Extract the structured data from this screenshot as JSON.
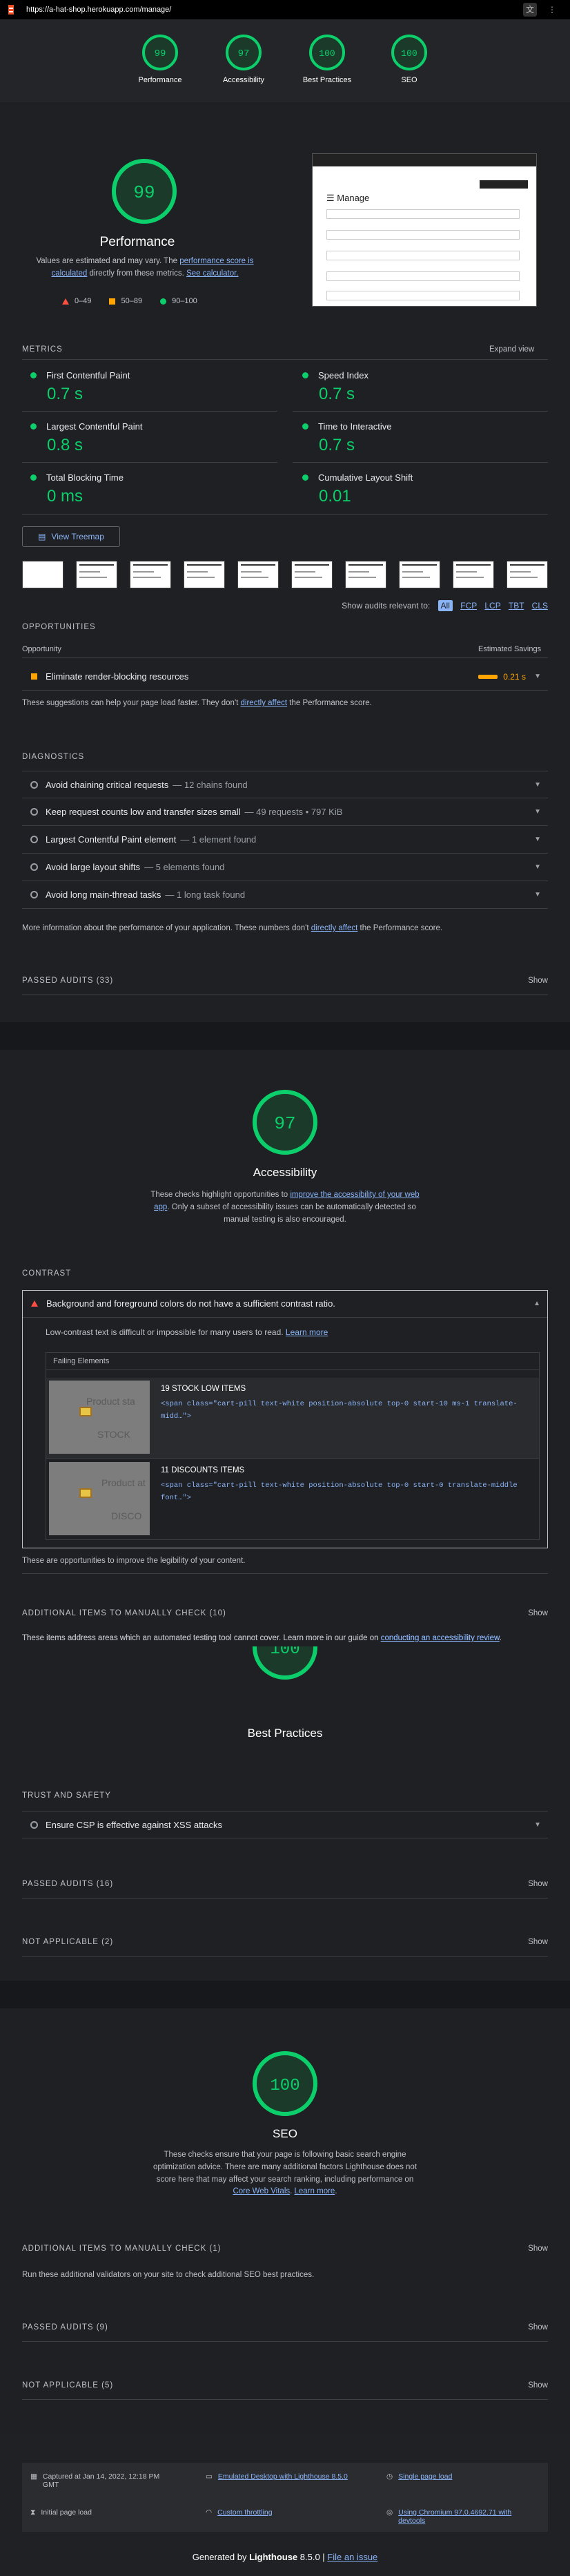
{
  "browser": {
    "url": "https://a-hat-shop.herokuapp.com/manage/"
  },
  "summary": [
    {
      "label": "Performance",
      "score": "99"
    },
    {
      "label": "Accessibility",
      "score": "97"
    },
    {
      "label": "Best Practices",
      "score": "100"
    },
    {
      "label": "SEO",
      "score": "100"
    }
  ],
  "performance": {
    "score": "99",
    "title": "Performance",
    "desc_1": "Values are estimated and may vary. The ",
    "desc_link_1": "performance score is calculated",
    "desc_2": " directly from these metrics. ",
    "desc_link_2": "See calculator.",
    "legend": [
      "0–49",
      "50–89",
      "90–100"
    ],
    "preview_title": "Manage",
    "metrics_header": "METRICS",
    "expand_view": "Expand view",
    "metrics": [
      {
        "name": "First Contentful Paint",
        "value": "0.7 s"
      },
      {
        "name": "Speed Index",
        "value": "0.7 s"
      },
      {
        "name": "Largest Contentful Paint",
        "value": "0.8 s"
      },
      {
        "name": "Time to Interactive",
        "value": "0.7 s"
      },
      {
        "name": "Total Blocking Time",
        "value": "0 ms"
      },
      {
        "name": "Cumulative Layout Shift",
        "value": "0.01"
      }
    ],
    "treemap": "View Treemap",
    "filter_label": "Show audits relevant to:",
    "filters": [
      "All",
      "FCP",
      "LCP",
      "TBT",
      "CLS"
    ],
    "opportunities_header": "OPPORTUNITIES",
    "opportunity_col": "Opportunity",
    "savings_col": "Estimated Savings",
    "opportunity": {
      "name": "Eliminate render-blocking resources",
      "savings": "0.21 s"
    },
    "opp_note_1": "These suggestions can help your page load faster. They don't ",
    "opp_note_link": "directly affect",
    "opp_note_2": " the Performance score.",
    "diagnostics_header": "DIAGNOSTICS",
    "diagnostics": [
      {
        "name": "Avoid chaining critical requests",
        "sub": "— 12 chains found"
      },
      {
        "name": "Keep request counts low and transfer sizes small",
        "sub": "— 49 requests • 797 KiB"
      },
      {
        "name": "Largest Contentful Paint element",
        "sub": "— 1 element found"
      },
      {
        "name": "Avoid large layout shifts",
        "sub": "— 5 elements found"
      },
      {
        "name": "Avoid long main-thread tasks",
        "sub": "— 1 long task found"
      }
    ],
    "diag_note_1": "More information about the performance of your application. These numbers don't ",
    "diag_note_link": "directly affect",
    "diag_note_2": " the Performance score.",
    "passed": "PASSED AUDITS (33)",
    "show": "Show"
  },
  "accessibility": {
    "score": "97",
    "title": "Accessibility",
    "desc_1": "These checks highlight opportunities to ",
    "desc_link": "improve the accessibility of your web app",
    "desc_2": ". Only a subset of accessibility issues can be automatically detected so manual testing is also encouraged.",
    "contrast_header": "CONTRAST",
    "contrast_audit": "Background and foreground colors do not have a sufficient contrast ratio.",
    "contrast_desc": "Low-contrast text is difficult or impossible for many users to read. ",
    "learn_more": "Learn more",
    "failing_header": "Failing Elements",
    "failing": [
      {
        "name": "19 STOCK LOW ITEMS",
        "code": "<span class=\"cart-pill text-white position-absolute top-0 start-10 ms-1 translate-midd…\">",
        "shot_text_1": "Product sta",
        "shot_text_2": "STOCK"
      },
      {
        "name": "11 DISCOUNTS ITEMS",
        "code": "<span class=\"cart-pill text-white position-absolute top-0 start-0 translate-middle font…\">",
        "shot_text_1": "Product at",
        "shot_text_2": "DISCO"
      }
    ],
    "contrast_note": "These are opportunities to improve the legibility of your content.",
    "manual_header": "ADDITIONAL ITEMS TO MANUALLY CHECK (10)",
    "manual_note_1": "These items address areas which an automated testing tool cannot cover. Learn more in our guide on ",
    "manual_note_link": "conducting an accessibility review",
    "manual_note_2": ".",
    "show": "Show"
  },
  "best_practices": {
    "score": "100",
    "title": "Best Practices",
    "trust_header": "TRUST AND SAFETY",
    "csp": "Ensure CSP is effective against XSS attacks",
    "passed": "PASSED AUDITS (16)",
    "na": "NOT APPLICABLE (2)",
    "show": "Show"
  },
  "seo": {
    "score": "100",
    "title": "SEO",
    "desc_1": "These checks ensure that your page is following basic search engine optimization advice. There are many additional factors Lighthouse does not score here that may affect your search ranking, including performance on ",
    "desc_link_1": "Core Web Vitals",
    "desc_2": ". ",
    "desc_link_2": "Learn more",
    "desc_3": ".",
    "manual_header": "ADDITIONAL ITEMS TO MANUALLY CHECK (1)",
    "manual_note": "Run these additional validators on your site to check additional SEO best practices.",
    "passed": "PASSED AUDITS (9)",
    "na": "NOT APPLICABLE (5)",
    "show": "Show"
  },
  "footer": {
    "captured": "Captured at Jan 14, 2022, 12:18 PM GMT",
    "emulated": "Emulated Desktop with Lighthouse 8.5.0",
    "single": "Single page load",
    "initial": "Initial page load",
    "throttling": "Custom throttling",
    "chromium": "Using Chromium 97.0.4692.71 with devtools",
    "generated": "Generated by ",
    "lighthouse": "Lighthouse",
    "version": " 8.5.0 | ",
    "file_issue": "File an issue"
  },
  "colors": {
    "pass": "#0cce6b",
    "average": "#ffa400",
    "fail": "#ff4e42",
    "link": "#8ab4f8"
  }
}
